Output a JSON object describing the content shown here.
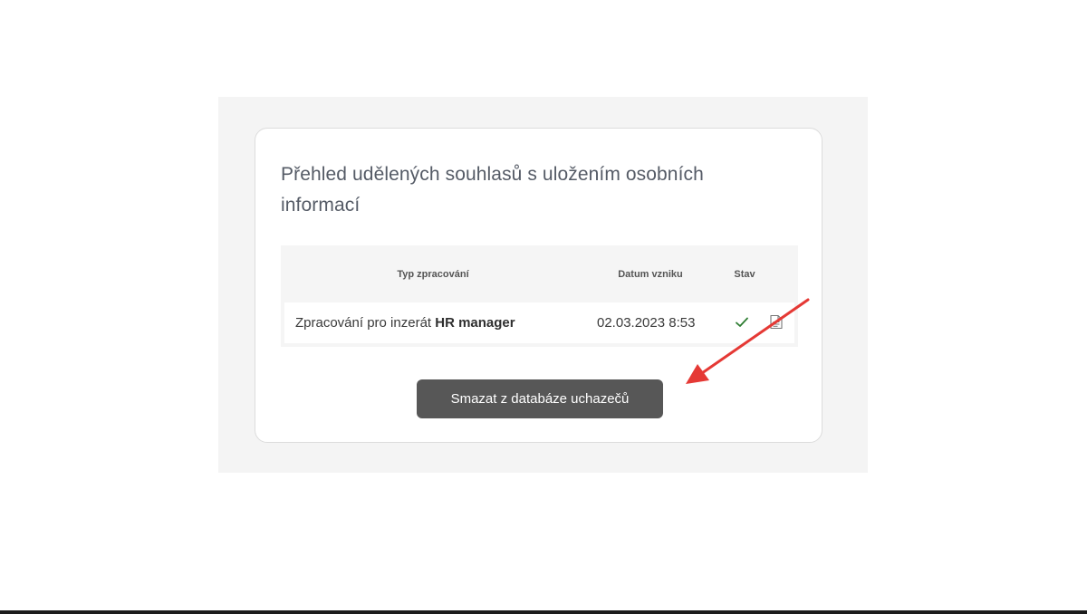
{
  "card": {
    "title": "Přehled udělených souhlasů s uložením osobních informací"
  },
  "table": {
    "headers": {
      "type": "Typ zpracování",
      "date": "Datum vzniku",
      "state": "Stav"
    },
    "rows": [
      {
        "type_prefix": "Zpracování pro inzerát ",
        "type_name": "HR manager",
        "date": "02.03.2023 8:53",
        "state_icon": "check-icon",
        "action_icon": "document-icon"
      }
    ]
  },
  "actions": {
    "delete_label": "Smazat z databáze uchazečů"
  },
  "colors": {
    "button": "#575757",
    "check": "#2e7d32",
    "annotation_arrow": "#e53935"
  }
}
